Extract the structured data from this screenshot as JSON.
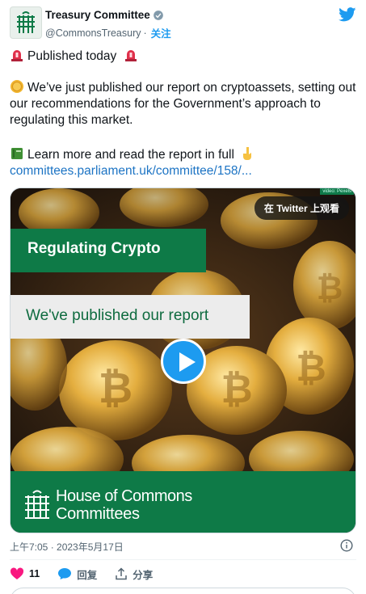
{
  "author": {
    "display_name": "Treasury Committee",
    "handle": "@CommonsTreasury",
    "separator": "·",
    "follow_label": "关注"
  },
  "tweet": {
    "line1": "Published today",
    "line2": "We’ve just published our report on cryptoassets, setting out our recommendations for the Government’s approach to regulating this market.",
    "line3": "Learn more and read the report in full",
    "link": "committees.parliament.uk/committee/158/..."
  },
  "media": {
    "watch_label": "在 Twitter 上观看",
    "watermark": "video: Pexels",
    "title": "Regulating Crypto",
    "subtitle": "We've published our report",
    "org_line1": "House of Commons",
    "org_line2": "Committees"
  },
  "meta": {
    "timestamp": "上午7:05 · 2023年5月17日"
  },
  "actions": {
    "like_count": "11",
    "reply_label": "回复",
    "share_label": "分享"
  },
  "colors": {
    "twitter_blue": "#1d9bf0",
    "parliament_green": "#0e7a47",
    "like_pink": "#f91880",
    "text_secondary": "#536471"
  },
  "icons": [
    "portcullis-icon",
    "verified-badge-icon",
    "twitter-bird-icon",
    "siren-icon",
    "coin-icon",
    "book-icon",
    "pointing-down-icon",
    "play-icon",
    "info-icon",
    "heart-icon",
    "reply-bubble-icon",
    "share-icon"
  ]
}
